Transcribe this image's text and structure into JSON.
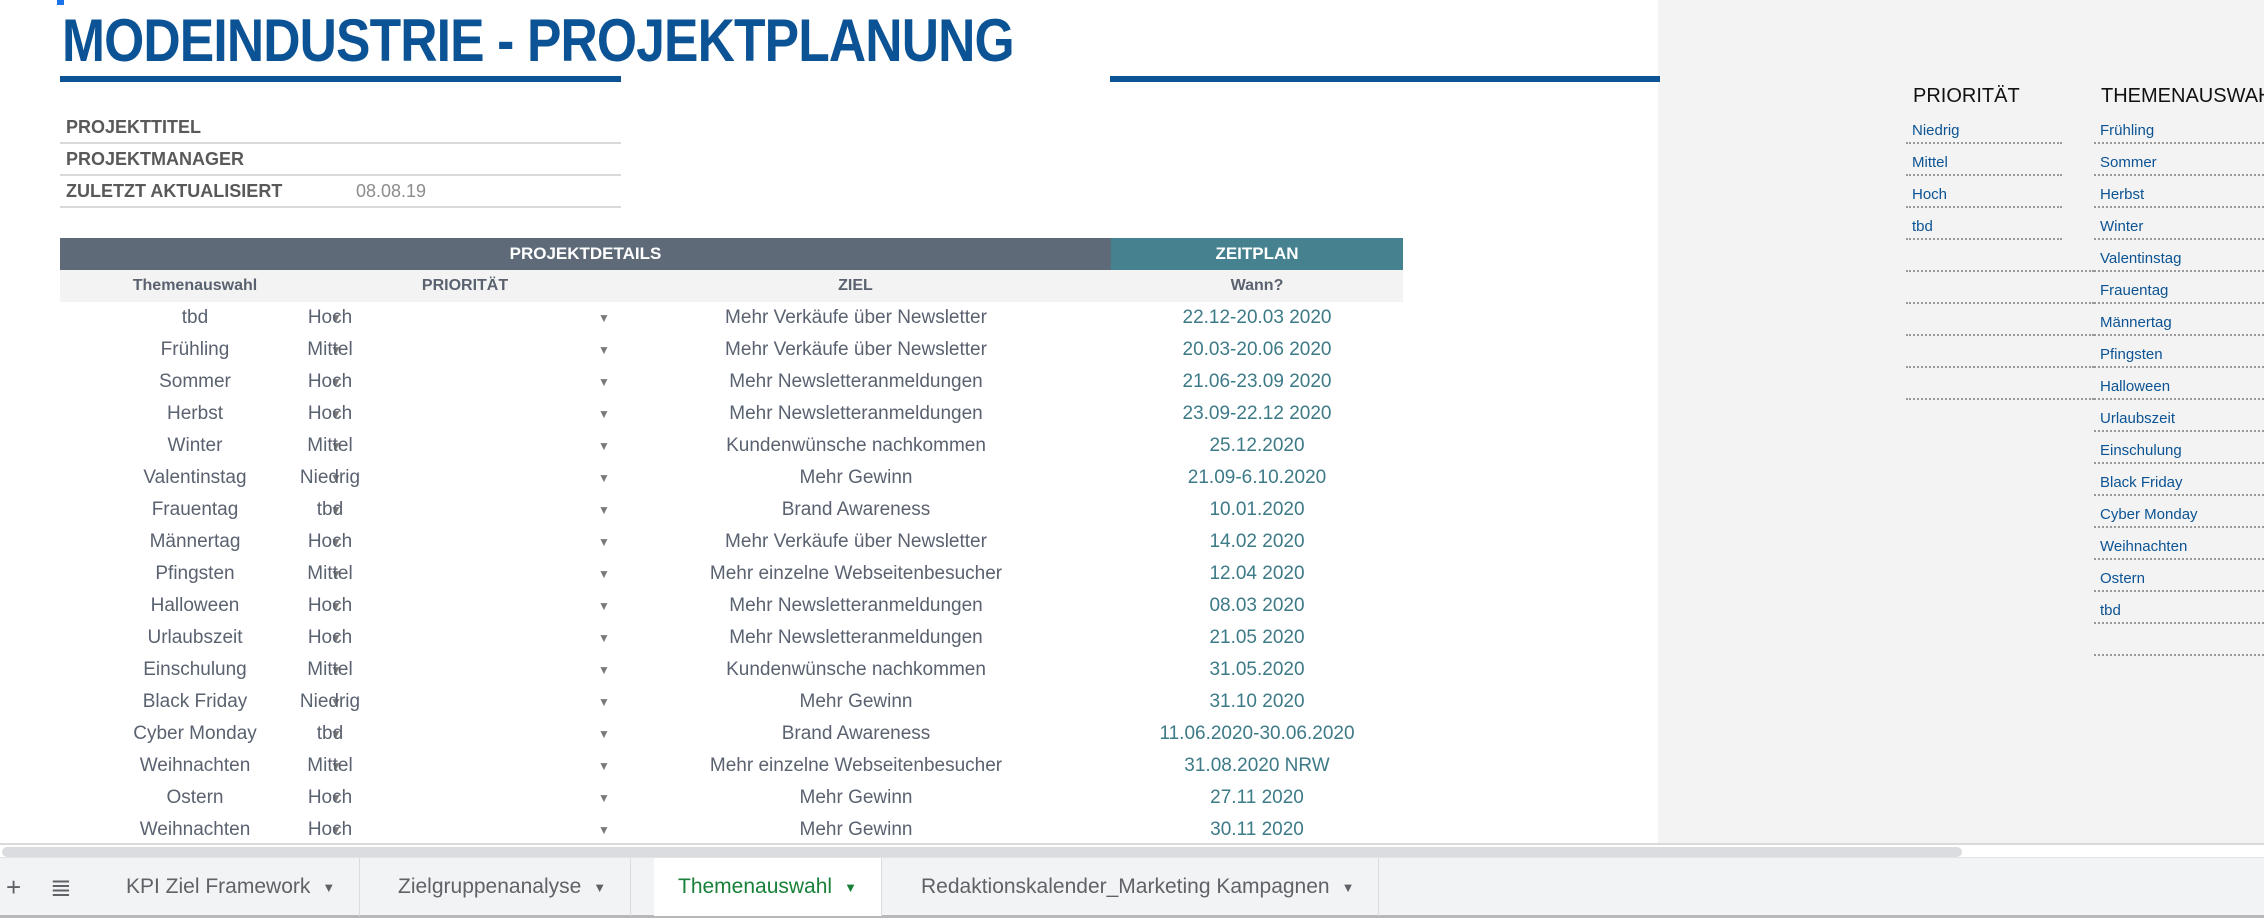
{
  "title": "MODEINDUSTRIE - PROJEKTPLANUNG",
  "colors": {
    "brand_blue": "#0b5394",
    "details_header": "#5e6a78",
    "zeitplan_header": "#45818e",
    "active_tab": "#188038"
  },
  "info": {
    "projekttitel_label": "PROJEKTTITEL",
    "projekttitel_value": "",
    "projektmanager_label": "PROJEKTMANAGER",
    "projektmanager_value": "",
    "aktualisiert_label": "ZULETZT AKTUALISIERT",
    "aktualisiert_value": "08.08.19"
  },
  "table": {
    "band_details": "PROJEKTDETAILS",
    "band_zeitplan": "ZEITPLAN",
    "columns": [
      "Themenauswahl",
      "PRIORITÄT",
      "ZIEL",
      "Wann?"
    ],
    "dropdown_icon": "▼",
    "rows": [
      {
        "thema": "tbd",
        "prio": "Hoch",
        "ziel": "Mehr Verkäufe über Newsletter",
        "wann": "22.12-20.03 2020"
      },
      {
        "thema": "Frühling",
        "prio": "Mittel",
        "ziel": "Mehr Verkäufe über Newsletter",
        "wann": "20.03-20.06 2020"
      },
      {
        "thema": "Sommer",
        "prio": "Hoch",
        "ziel": "Mehr Newsletteranmeldungen",
        "wann": "21.06-23.09 2020"
      },
      {
        "thema": "Herbst",
        "prio": "Hoch",
        "ziel": "Mehr Newsletteranmeldungen",
        "wann": "23.09-22.12 2020"
      },
      {
        "thema": "Winter",
        "prio": "Mittel",
        "ziel": "Kundenwünsche nachkommen",
        "wann": "25.12.2020"
      },
      {
        "thema": "Valentinstag",
        "prio": "Niedrig",
        "ziel": "Mehr Gewinn",
        "wann": "21.09-6.10.2020"
      },
      {
        "thema": "Frauentag",
        "prio": "tbd",
        "ziel": "Brand Awareness",
        "wann": "10.01.2020"
      },
      {
        "thema": "Männertag",
        "prio": "Hoch",
        "ziel": "Mehr Verkäufe über Newsletter",
        "wann": "14.02 2020"
      },
      {
        "thema": "Pfingsten",
        "prio": "Mittel",
        "ziel": "Mehr einzelne Webseitenbesucher",
        "wann": "12.04 2020"
      },
      {
        "thema": "Halloween",
        "prio": "Hoch",
        "ziel": "Mehr Newsletteranmeldungen",
        "wann": "08.03 2020"
      },
      {
        "thema": "Urlaubszeit",
        "prio": "Hoch",
        "ziel": "Mehr Newsletteranmeldungen",
        "wann": "21.05 2020"
      },
      {
        "thema": "Einschulung",
        "prio": "Mittel",
        "ziel": "Kundenwünsche nachkommen",
        "wann": "31.05.2020"
      },
      {
        "thema": "Black Friday",
        "prio": "Niedrig",
        "ziel": "Mehr Gewinn",
        "wann": "31.10 2020"
      },
      {
        "thema": "Cyber Monday",
        "prio": "tbd",
        "ziel": "Brand Awareness",
        "wann": "11.06.2020-30.06.2020"
      },
      {
        "thema": "Weihnachten",
        "prio": "Mittel",
        "ziel": "Mehr einzelne Webseitenbesucher",
        "wann": "31.08.2020 NRW"
      },
      {
        "thema": "Ostern",
        "prio": "Hoch",
        "ziel": "Mehr Gewinn",
        "wann": "27.11 2020"
      },
      {
        "thema": "Weihnachten",
        "prio": "Hoch",
        "ziel": "Mehr Gewinn",
        "wann": "30.11 2020"
      }
    ]
  },
  "lists": {
    "prio_heading": "PRIORITÄT",
    "prio_items": [
      "Niedrig",
      "Mittel",
      "Hoch",
      "tbd"
    ],
    "theme_heading": "THEMENAUSWAHL",
    "theme_items": [
      "Frühling",
      "Sommer",
      "Herbst",
      "Winter",
      "Valentinstag",
      "Frauentag",
      "Männertag",
      "Pfingsten",
      "Halloween",
      "Urlaubszeit",
      "Einschulung",
      "Black Friday",
      "Cyber Monday",
      "Weihnachten",
      "Ostern",
      "tbd",
      ""
    ]
  },
  "tabs": {
    "add_icon": "+",
    "menu_icon": "≣",
    "arrow_icon": "▼",
    "items": [
      {
        "label": "KPI Ziel Framework",
        "active": false
      },
      {
        "label": "Zielgruppenanalyse",
        "active": false
      },
      {
        "label": "Themenauswahl",
        "active": true
      },
      {
        "label": "Redaktionskalender_Marketing Kampagnen",
        "active": false
      }
    ]
  }
}
